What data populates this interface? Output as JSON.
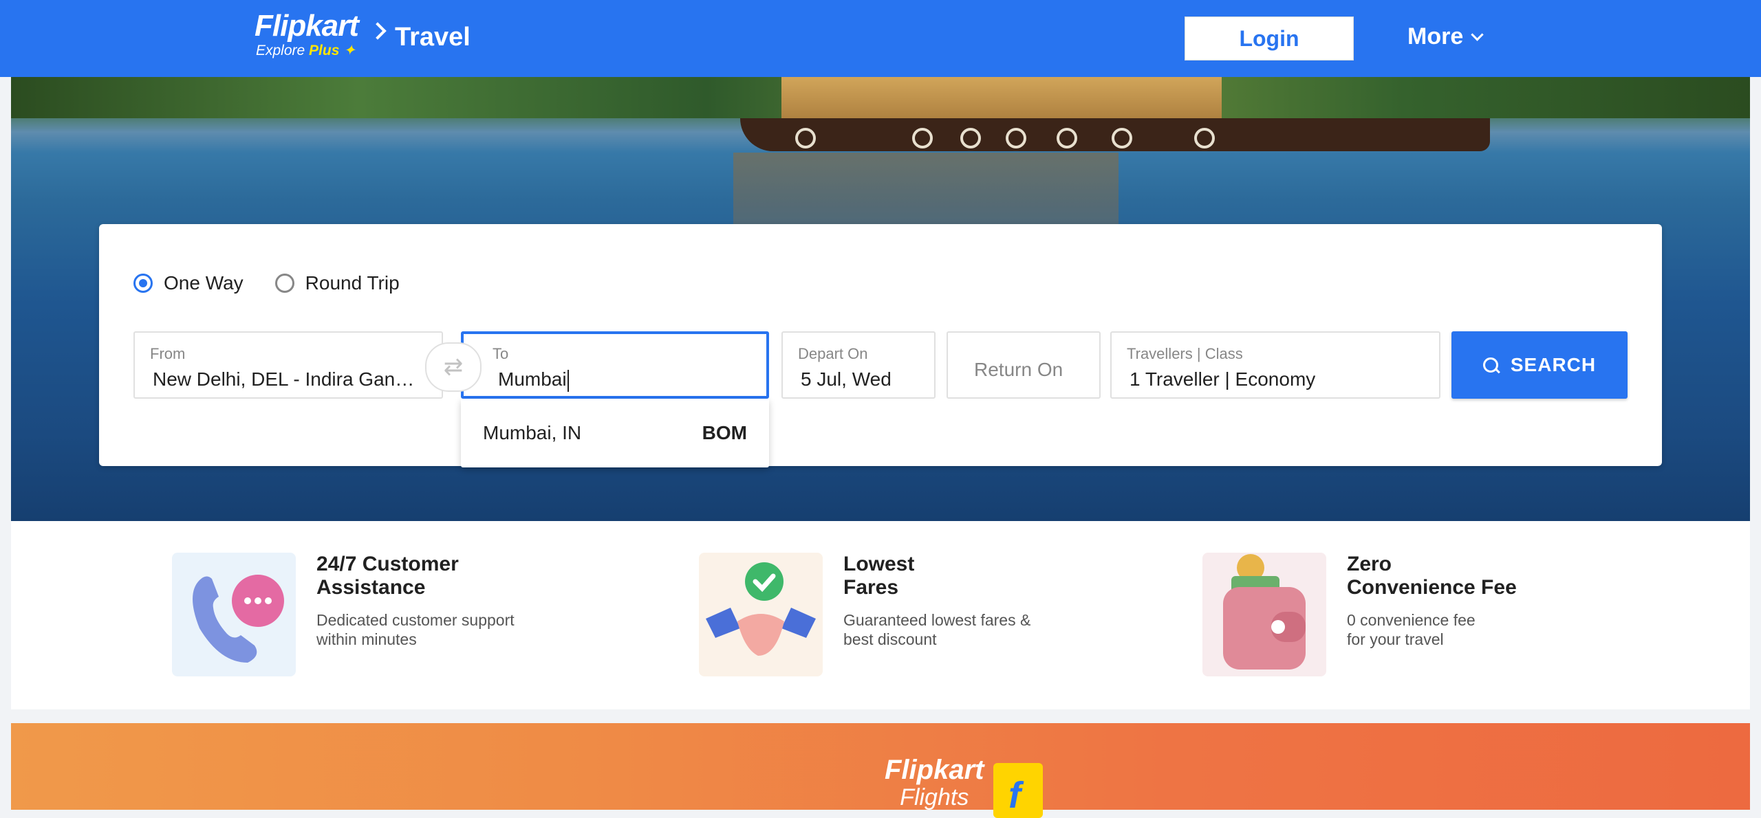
{
  "header": {
    "logo_main": "Flipkart",
    "logo_sub": "Explore",
    "logo_plus": "Plus",
    "breadcrumb": "Travel",
    "login_label": "Login",
    "more_label": "More"
  },
  "search_card": {
    "trip_types": [
      {
        "label": "One Way",
        "selected": true
      },
      {
        "label": "Round Trip",
        "selected": false
      }
    ],
    "from": {
      "label": "From",
      "value": "New Delhi, DEL - Indira Gandhi Airport"
    },
    "to": {
      "label": "To",
      "value": "Mumbai"
    },
    "depart": {
      "label": "Depart On",
      "value": "5 Jul, Wed"
    },
    "return": {
      "placeholder": "Return On"
    },
    "travellers": {
      "label": "Travellers | Class",
      "value": "1 Traveller | Economy"
    },
    "search_label": "SEARCH",
    "suggestions": [
      {
        "city": "Mumbai, IN",
        "code": "BOM"
      }
    ]
  },
  "features": [
    {
      "title_line1": "24/7 Customer",
      "title_line2": "Assistance",
      "desc_line1": "Dedicated customer support",
      "desc_line2": "within minutes",
      "icon": "phone-chat-icon"
    },
    {
      "title_line1": "Lowest",
      "title_line2": "Fares",
      "desc_line1": "Guaranteed lowest fares &",
      "desc_line2": "best discount",
      "icon": "handshake-icon"
    },
    {
      "title_line1": "Zero",
      "title_line2": "Convenience Fee",
      "desc_line1": "0 convenience fee",
      "desc_line2": "for your travel",
      "icon": "wallet-icon"
    }
  ],
  "promo": {
    "logo_main": "Flipkart",
    "logo_sub": "Flights"
  },
  "colors": {
    "brand": "#2874f0",
    "promo": "#ef8b46"
  }
}
